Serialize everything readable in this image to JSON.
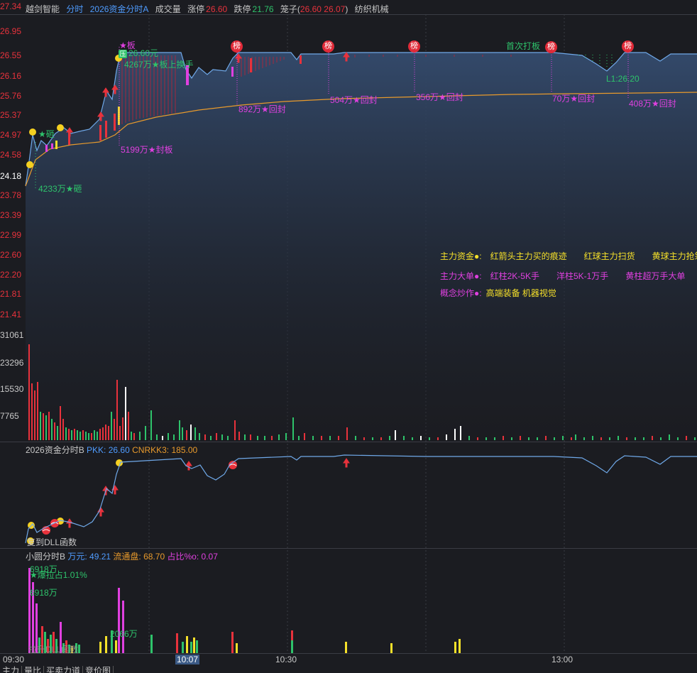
{
  "header": {
    "stock": "越剑智能",
    "mode": "分时",
    "indicator": "2026资金分时A",
    "volume_label": "成交量",
    "limit_up_label": "涨停",
    "limit_up": "26.60",
    "limit_down_label": "跌停",
    "limit_down": "21.76",
    "cage_label": "笼子(",
    "cage_values": "26.60 26.07",
    "cage_close": ")",
    "sector": "纺织机械"
  },
  "price_axis": [
    "27.34",
    "26.95",
    "26.55",
    "26.16",
    "25.76",
    "25.37",
    "24.97",
    "24.58",
    "24.18",
    "23.78",
    "23.39",
    "22.99",
    "22.60",
    "22.20",
    "21.81",
    "21.41"
  ],
  "volume_axis": [
    "31061",
    "23296",
    "15530",
    "7765"
  ],
  "annotations": {
    "a1": "★砸",
    "a2": "4233万★砸",
    "a3": "★板",
    "a4": "26.60元",
    "a5": "4267万★板上换手",
    "a6": "5199万★封板",
    "a7": "892万★回封",
    "a8": "504万★回封",
    "a9": "356万★回封",
    "a10": "首次打板",
    "a11": "70万★回封",
    "a12": "408万★回封",
    "a13": "L1:26.20",
    "rank": "榜",
    "ya": "压"
  },
  "legend": {
    "row1": [
      "主力资金●:",
      "红箭头主力买的痕迹",
      "红球主力扫货",
      "黄球主力抢筹"
    ],
    "row2": [
      "主力大单●:",
      "红柱2K-5K手",
      "洋柱5K-1万手",
      "黄柱超万手大单"
    ],
    "row3_label": "概念炒作●:",
    "row3_value": "高端装备 机器视觉"
  },
  "panel2": {
    "title": "2026资金分时B",
    "pkk_label": "PKK:",
    "pkk": "26.60",
    "cn_label": "CNRKK3:",
    "cn": "185.00",
    "note": "复到DLL函数"
  },
  "panel3": {
    "title": "小圆分时B",
    "wan_label": "万元:",
    "wan": "49.21",
    "float_label": "流通盘:",
    "float": "68.70",
    "ratio_label": "占比%o:",
    "ratio": "0.07",
    "n1": "6918万",
    "n2": "★爆拉占1.01%",
    "n3": "6918万",
    "n4": "2066万",
    "n5": "拉升DLL函数"
  },
  "time_axis": [
    "09:30",
    "10:07",
    "10:30",
    "13:00"
  ],
  "tabs": [
    "主力",
    "量比",
    "买卖力道",
    "竞价图"
  ],
  "colors": {
    "up": "#e8323c",
    "down": "#2ec36b",
    "price_line": "#6fa8e8",
    "avg_line": "#e89a2c",
    "magenta": "#e040e0",
    "yellow": "#f5e02a",
    "blue_text": "#4f9cff"
  }
}
